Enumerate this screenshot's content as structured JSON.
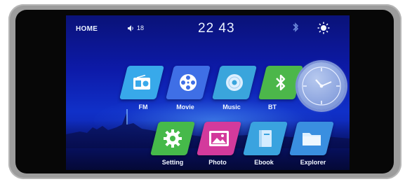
{
  "status_bar": {
    "home_label": "HOME",
    "volume_icon": "speaker-icon",
    "volume_value": "18",
    "time": "22 43",
    "bluetooth_icon": "bluetooth-icon",
    "brightness_icon": "brightness-icon"
  },
  "apps": [
    {
      "label": "FM",
      "icon": "radio-icon",
      "color": "#38a9ea"
    },
    {
      "label": "Movie",
      "icon": "film-reel-icon",
      "color": "#3f6fe6"
    },
    {
      "label": "Music",
      "icon": "disc-icon",
      "color": "#3aa5dc"
    },
    {
      "label": "BT",
      "icon": "bluetooth-icon",
      "color": "#4cb74a"
    },
    {
      "label": "Setting",
      "icon": "gear-icon",
      "color": "#46b94a"
    },
    {
      "label": "Photo",
      "icon": "picture-icon",
      "color": "#d33a9c"
    },
    {
      "label": "Ebook",
      "icon": "book-icon",
      "color": "#3aa3df"
    },
    {
      "label": "Explorer",
      "icon": "folder-icon",
      "color": "#3a8fe0"
    }
  ],
  "analog_clock": {
    "icon": "analog-clock-icon"
  }
}
